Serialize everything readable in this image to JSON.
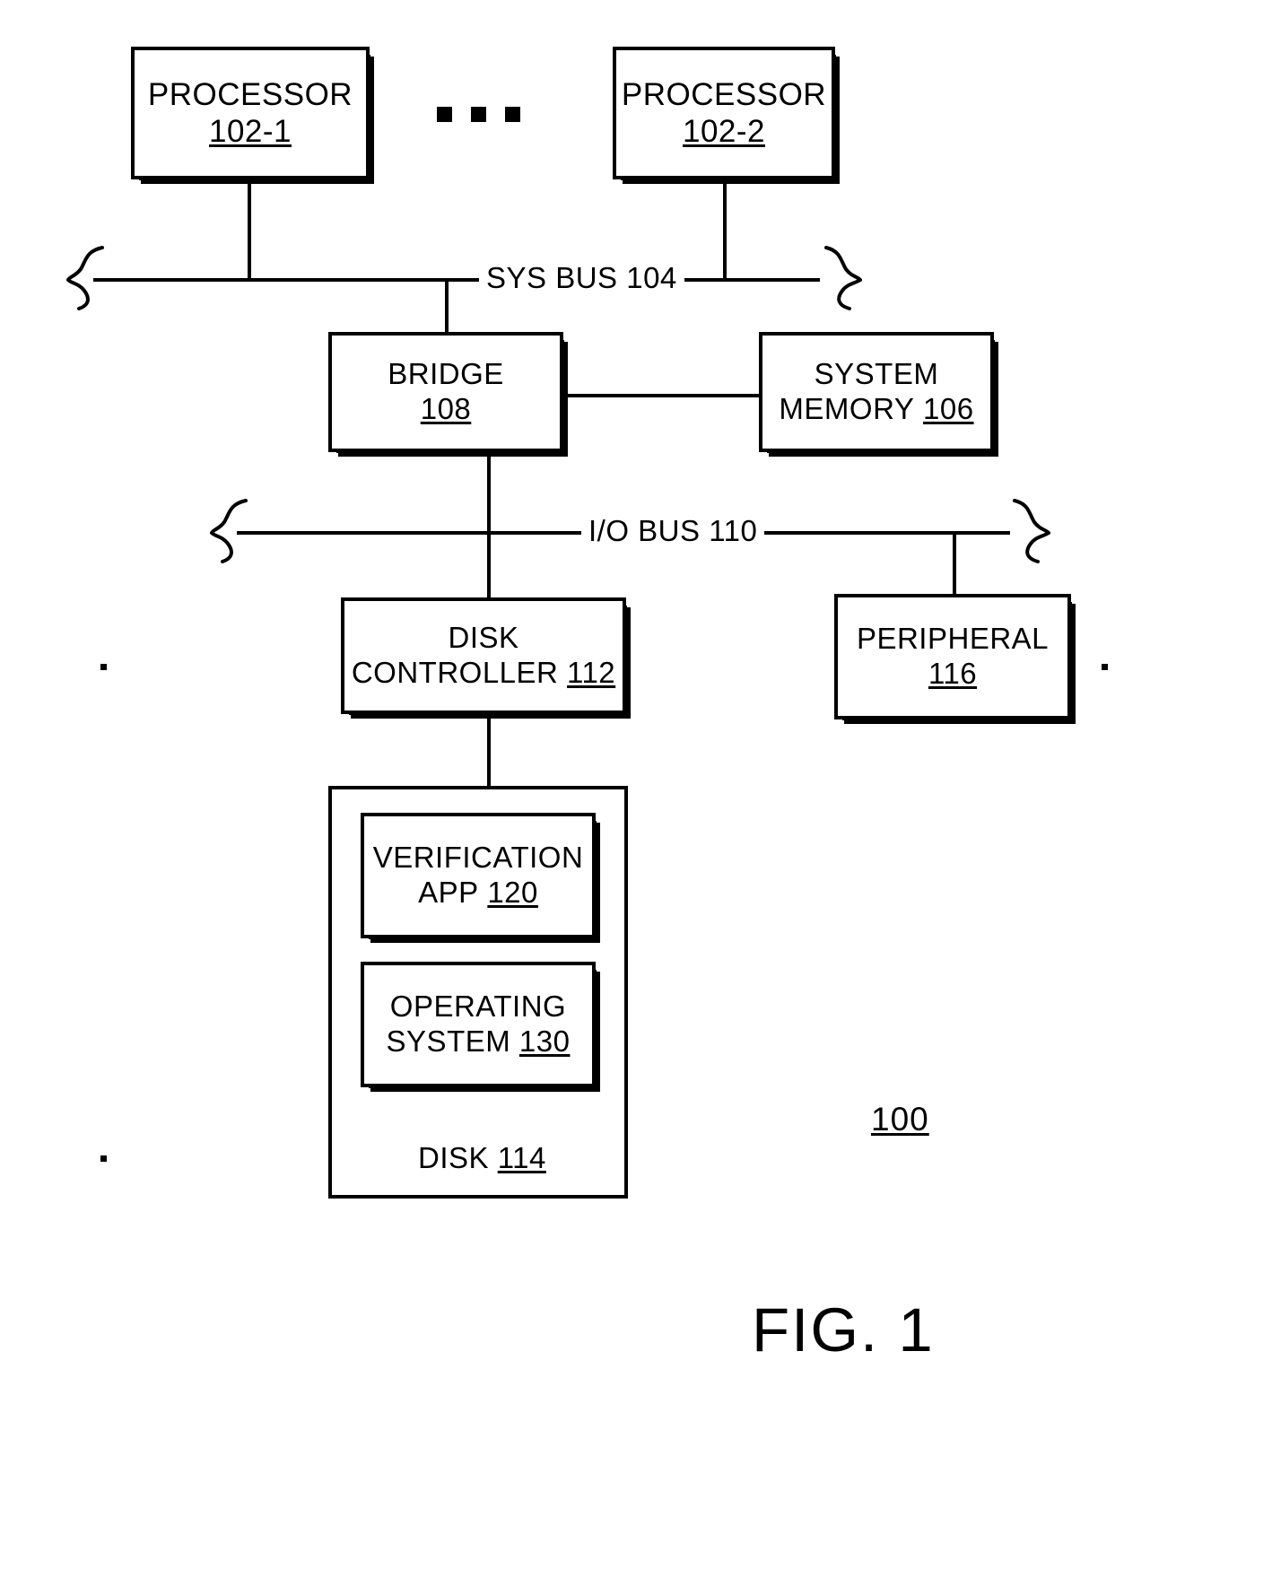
{
  "figure": {
    "caption": "FIG. 1",
    "system_ref": "100"
  },
  "blocks": {
    "processor_1": {
      "title": "PROCESSOR",
      "ref": "102-1"
    },
    "processor_2": {
      "title": "PROCESSOR",
      "ref": "102-2"
    },
    "bridge": {
      "title": "BRIDGE",
      "ref": "108"
    },
    "system_memory": {
      "title": "SYSTEM",
      "subtitle": "MEMORY",
      "ref": "106"
    },
    "disk_controller": {
      "title": "DISK",
      "subtitle": "CONTROLLER",
      "ref": "112"
    },
    "peripheral": {
      "title": "PERIPHERAL",
      "ref": "116"
    },
    "verification_app": {
      "title": "VERIFICATION",
      "subtitle": "APP",
      "ref": "120"
    },
    "operating_system": {
      "title": "OPERATING",
      "subtitle": "SYSTEM",
      "ref": "130"
    },
    "disk": {
      "title": "DISK",
      "ref": "114"
    }
  },
  "buses": {
    "sys_bus": {
      "label": "SYS BUS 104"
    },
    "io_bus": {
      "label": "I/O BUS 110"
    }
  },
  "ellipsis": {
    "label": "• • •"
  }
}
